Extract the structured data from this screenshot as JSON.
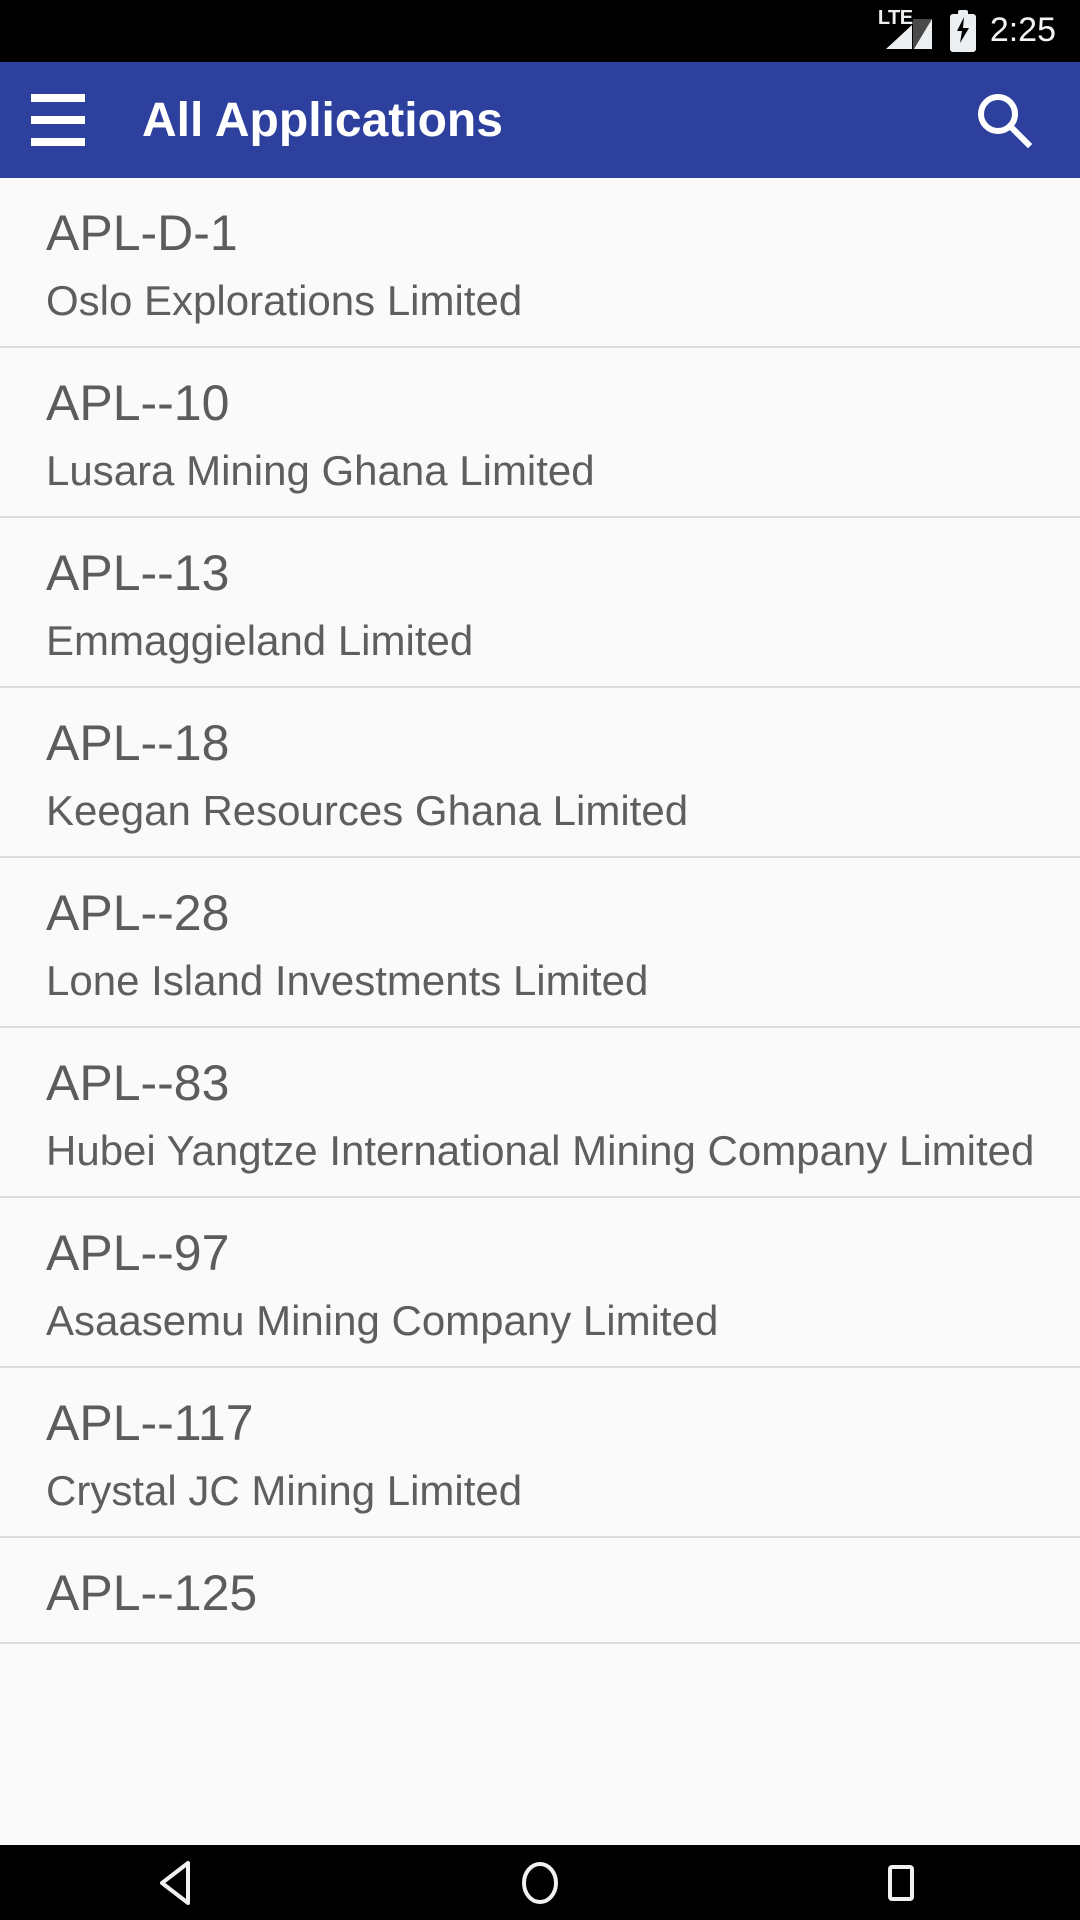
{
  "status_bar": {
    "network_label": "LTE",
    "signal_icon": "signal-triangle-icon",
    "battery_icon": "battery-charging-icon",
    "time": "2:25"
  },
  "app_bar": {
    "menu_icon": "hamburger-menu-icon",
    "title": "All Applications",
    "search_icon": "search-icon",
    "background_color": "#2E409E"
  },
  "list": {
    "items": [
      {
        "code": "APL-D-1",
        "company": "Oslo Explorations Limited"
      },
      {
        "code": "APL--10",
        "company": "Lusara Mining Ghana Limited"
      },
      {
        "code": "APL--13",
        "company": "Emmaggieland Limited"
      },
      {
        "code": "APL--18",
        "company": "Keegan Resources Ghana Limited"
      },
      {
        "code": "APL--28",
        "company": "Lone Island Investments Limited"
      },
      {
        "code": "APL--83",
        "company": "Hubei Yangtze International Mining Company Limited"
      },
      {
        "code": "APL--97",
        "company": "Asaasemu Mining Company Limited"
      },
      {
        "code": "APL--117",
        "company": "Crystal JC Mining Limited"
      },
      {
        "code": "APL--125",
        "company": ""
      }
    ]
  },
  "nav_bar": {
    "back_icon": "back-triangle-icon",
    "home_icon": "home-circle-icon",
    "recents_icon": "recents-square-icon"
  }
}
